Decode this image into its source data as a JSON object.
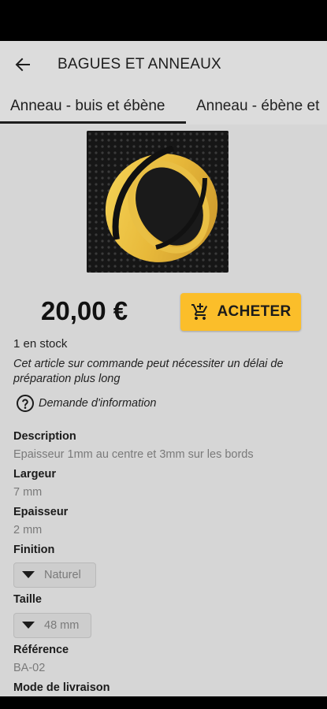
{
  "header": {
    "title": "BAGUES ET ANNEAUX"
  },
  "tabs": [
    {
      "label": "Anneau - buis et ébène"
    },
    {
      "label": "Anneau - ébène et"
    }
  ],
  "product": {
    "price": "20,00 €",
    "buy_label": "ACHETER",
    "stock": "1 en stock",
    "note": "Cet article sur commande peut nécessiter un délai de préparation plus long",
    "info_link": "Demande d'information"
  },
  "details": {
    "description_label": "Description",
    "description_value": "Epaisseur 1mm au centre et 3mm sur les bords",
    "largeur_label": "Largeur",
    "largeur_value": "7 mm",
    "epaisseur_label": "Epaisseur",
    "epaisseur_value": "2 mm",
    "finition_label": "Finition",
    "finition_selected": "Naturel",
    "taille_label": "Taille",
    "taille_selected": "48 mm",
    "reference_label": "Référence",
    "reference_value": "BA-02",
    "livraison_label": "Mode de livraison"
  },
  "colors": {
    "accent": "#fbbe2a",
    "background": "#d6d6d6",
    "toolbar": "#dcdcdc"
  },
  "icons": {
    "back": "arrow-left-icon",
    "cart": "add-shopping-cart-icon",
    "help": "help-circle-icon",
    "dropdown": "triangle-down-icon"
  }
}
